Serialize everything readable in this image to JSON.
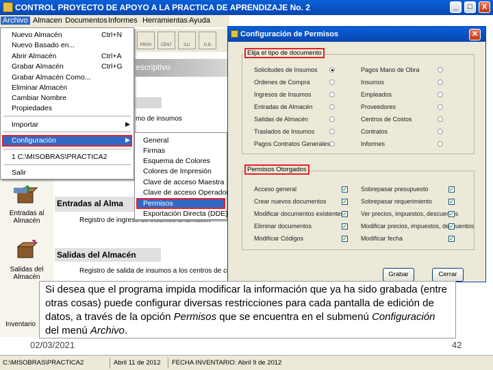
{
  "window": {
    "title": "CONTROL   PROYECTO DE APOYO A LA PRACTICA DE APRENDIZAJE No. 2",
    "controls": [
      "_",
      "□",
      "X"
    ]
  },
  "menubar": {
    "items": [
      "Archivo",
      "Almacen",
      "Documentos",
      "Informes",
      "Herramientas",
      "Ayuda"
    ]
  },
  "archivo_menu": {
    "items": [
      {
        "label": "Nuevo Almacén",
        "shortcut": "Ctrl+N"
      },
      {
        "label": "Nuevo Basado en...",
        "shortcut": ""
      },
      {
        "label": "Abrir Almacén",
        "shortcut": "Ctrl+A"
      },
      {
        "label": "Grabar Almacén",
        "shortcut": "Ctrl+G"
      },
      {
        "label": "Grabar Almacén Como...",
        "shortcut": ""
      },
      {
        "label": "Eliminar Almacén",
        "shortcut": ""
      },
      {
        "label": "Cambiar Nombre",
        "shortcut": ""
      },
      {
        "label": "Propiedades",
        "shortcut": ""
      }
    ],
    "importar": "Importar",
    "configuracion": "Configuración",
    "recent": "1 C:\\MISOBRAS\\PRACTICA2",
    "salir": "Salir"
  },
  "config_submenu": {
    "items": [
      "General",
      "Firmas",
      "Esquema de Colores",
      "Colores de Impresión",
      "Clave de acceso Maestra",
      "Clave de acceso Operador",
      "Permisos",
      "Exportación Directa (DDE)"
    ],
    "selected": "Permisos"
  },
  "background": {
    "toolbar_buttons": [
      "PROV",
      "CENT",
      "CLI",
      "D.B"
    ],
    "descr_strip": "escriptivo",
    "partial_text": "mo de insumos",
    "left_items": [
      {
        "label": "Entradas al Almacén"
      },
      {
        "label": "Salidas del Almacén"
      },
      {
        "label": "Inventario"
      }
    ],
    "sections": [
      {
        "title": "Entradas al Alma",
        "desc": "Registro de ingreso de insumos al almacén"
      },
      {
        "title": "Salidas del Almacén",
        "desc": "Registro de salida de insumos a los centros de cos"
      }
    ]
  },
  "dialog": {
    "title": "Configuración de Permisos",
    "doc_group_label": "Elija el tipo de documento",
    "doc_left": [
      "Solicitudes de Insumos",
      "Ordenes de Compra",
      "Ingresos de Insumos",
      "Entradas de Almacén",
      "Salidas de Almacén",
      "Traslados de Insumos",
      "Pagos Contratos Generales"
    ],
    "doc_right": [
      "Pagos Mano de Obra",
      "Insumos",
      "Empleados",
      "Proveedores",
      "Centros de Costos",
      "Contratos",
      "Informes"
    ],
    "doc_selected": "Solicitudes de Insumos",
    "perm_group_label": "Permisos Otorgados",
    "perm_left": [
      "Acceso general",
      "Crear nuevos documentos",
      "Modificar documentos existentes",
      "Eliminar documentos",
      "Modificar Códigos"
    ],
    "perm_right": [
      "Sobrepasar presupuesto",
      "Sobrepasar requerimiento",
      "Ver precios, impuestos, descuentos",
      "Modificar precios, impuestos, descuentos",
      "Modificar fecha"
    ],
    "grabar": "Grabar",
    "cerrar": "Cerrar",
    "accent_color": "#e8202a"
  },
  "caption": {
    "text_before": "Si desea que el programa impida modificar la información que ya ha sido grabada (entre otras cosas) puede configurar diversas restricciones para cada pantalla de edición de datos, a través de la opción ",
    "em1": "Permisos",
    "text_mid": " que se encuentra en el submenú ",
    "em2": "Configuración",
    "text_mid2": " del menú ",
    "em3": "Archivo",
    "text_end": "."
  },
  "slide": {
    "date": "02/03/2021",
    "page": "42"
  },
  "statusbar": {
    "path": "C:\\MISOBRAS\\PRACTICA2",
    "date": "Abril 11 de 2012",
    "inventory": "FECHA INVENTARIO: Abril 9 de 2012"
  }
}
